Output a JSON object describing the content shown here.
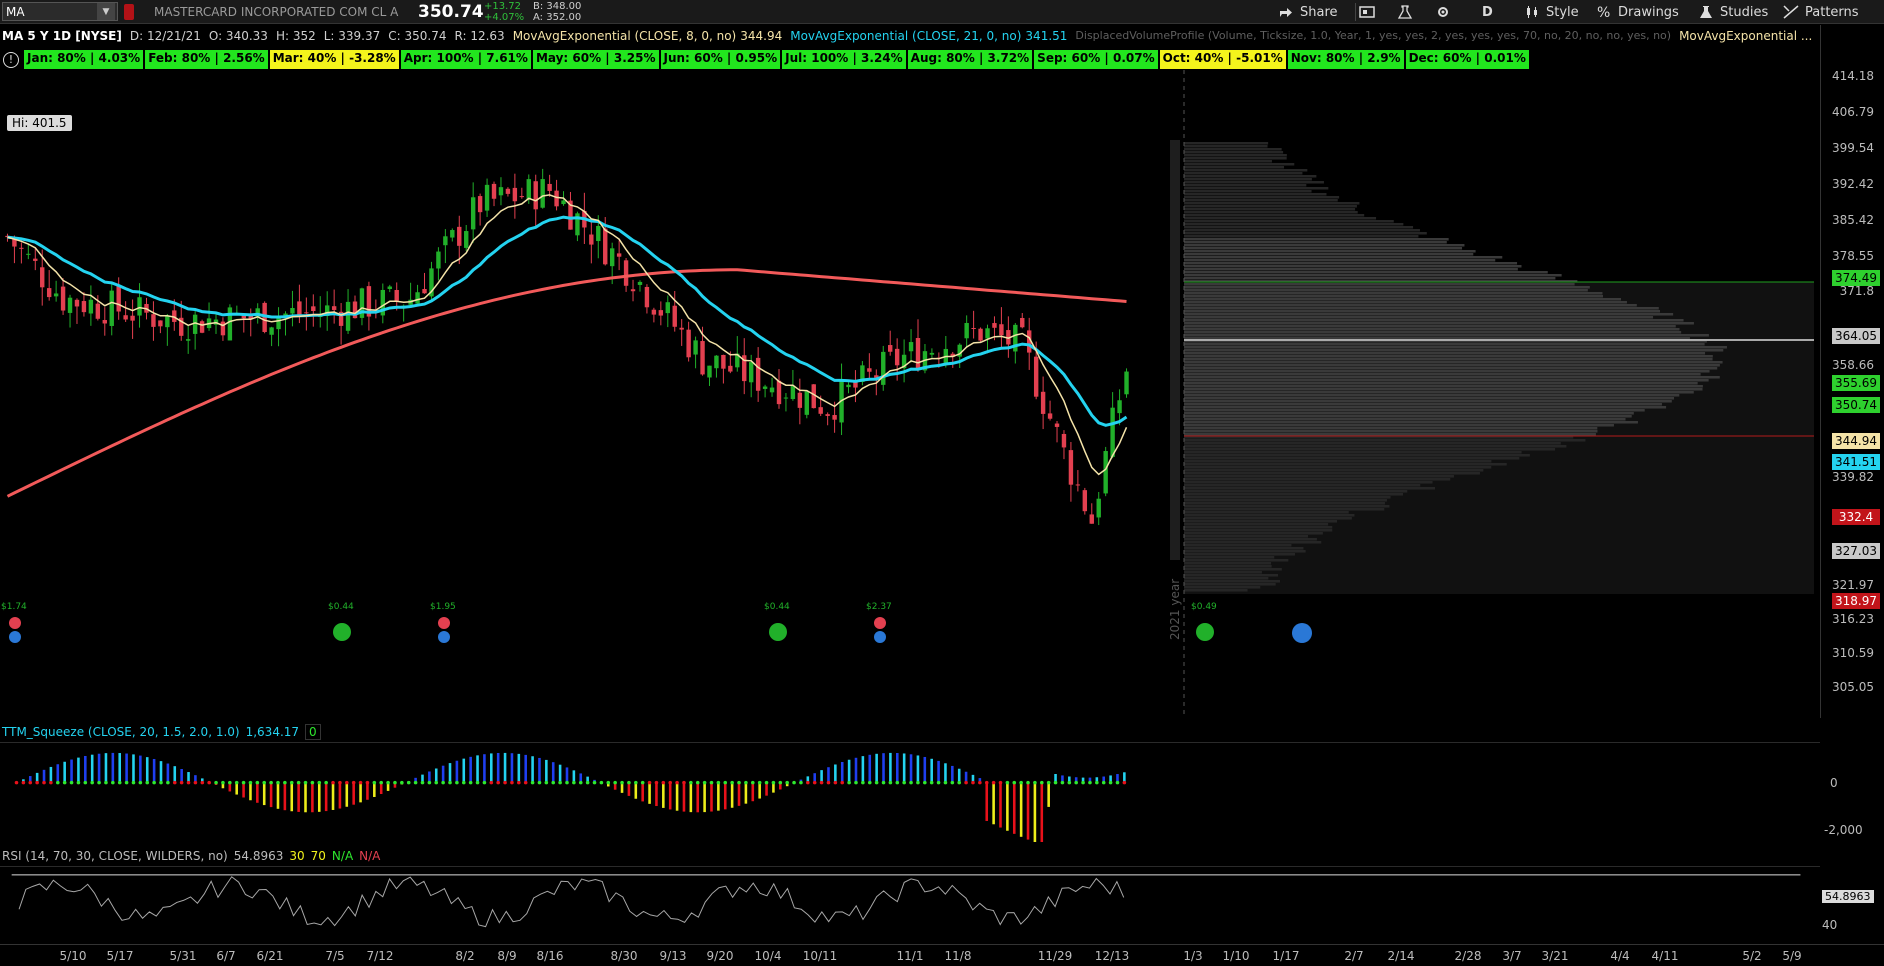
{
  "header": {
    "symbol": "MA",
    "company": "MASTERCARD INCORPORATED COM CL A",
    "last": "350.74",
    "net_change": "+13.72",
    "pct_change": "+4.07%",
    "bid": "B: 348.00",
    "ask": "A: 352.00",
    "share_label": "Share",
    "aggregation": "D",
    "style_label": "Style",
    "drawings_label": "Drawings",
    "studies_label": "Studies",
    "patterns_label": "Patterns"
  },
  "study_strip": {
    "chart_id": "MA 5 Y 1D [NYSE]",
    "date": "D: 12/21/21",
    "open": "O: 340.33",
    "high": "H: 352",
    "low": "L: 339.37",
    "close": "C: 350.74",
    "range": "R: 12.63",
    "ema8_label": "MovAvgExponential (CLOSE, 8, 0, no)",
    "ema8_value": "344.94",
    "ema21_label": "MovAvgExponential (CLOSE, 21, 0, no)",
    "ema21_value": "341.51",
    "dvp_label": "DisplacedVolumeProfile (Volume, Ticksize, 1.0, Year, 1, yes, yes, 2, yes, yes, yes, 70, no, 20, no, no, yes, no)",
    "ema_more_label": "MovAvgExponential ..."
  },
  "seasonality": [
    {
      "text": "Jan: 80% | 4.03%",
      "color": "#22e61e"
    },
    {
      "text": "Feb: 80% | 2.56%",
      "color": "#22e61e"
    },
    {
      "text": "Mar: 40% | -3.28%",
      "color": "#f4f41c"
    },
    {
      "text": "Apr: 100% | 7.61%",
      "color": "#22e61e"
    },
    {
      "text": "May: 60% | 3.25%",
      "color": "#22e61e"
    },
    {
      "text": "Jun: 60% | 0.95%",
      "color": "#22e61e"
    },
    {
      "text": "Jul: 100% | 3.24%",
      "color": "#22e61e"
    },
    {
      "text": "Aug: 80% | 3.72%",
      "color": "#22e61e"
    },
    {
      "text": "Sep: 60% | 0.07%",
      "color": "#22e61e"
    },
    {
      "text": "Oct: 40% | -5.01%",
      "color": "#f4f41c"
    },
    {
      "text": "Nov: 80% | 2.9%",
      "color": "#22e61e"
    },
    {
      "text": "Dec: 60% | 0.01%",
      "color": "#22e61e"
    }
  ],
  "hi_label": "Hi: 401.5",
  "period_label": "2021 year",
  "price_axis": [
    "414.18",
    "406.79",
    "399.54",
    "392.42",
    "385.42",
    "378.55",
    "371.8",
    "358.66",
    "339.82",
    "321.97",
    "316.23",
    "310.59",
    "305.05"
  ],
  "price_tags": [
    {
      "text": "374.49",
      "color": "#2ed02e"
    },
    {
      "text": "364.05",
      "color": "#c8c8c8"
    },
    {
      "text": "355.69",
      "color": "#2ed02e"
    },
    {
      "text": "350.74",
      "color": "#2ed02e"
    },
    {
      "text": "344.94",
      "color": "#f4e3a8"
    },
    {
      "text": "341.51",
      "color": "#24d3f0"
    },
    {
      "text": "332.4",
      "color": "#c2141a"
    },
    {
      "text": "327.03",
      "color": "#c8c8c8"
    },
    {
      "text": "318.97",
      "color": "#c2141a"
    }
  ],
  "dividends": [
    {
      "date_value": "$1.74",
      "kind": "earnings"
    },
    {
      "date_value": "$0.44",
      "kind": "dividend"
    },
    {
      "date_value": "$1.95",
      "kind": "earnings"
    },
    {
      "date_value": "$0.44",
      "kind": "dividend"
    },
    {
      "date_value": "$2.37",
      "kind": "earnings"
    },
    {
      "date_value": "$0.49",
      "kind": "dividend"
    }
  ],
  "squeeze": {
    "label": "TTM_Squeeze (CLOSE, 20, 1.5, 2.0, 1.0)",
    "value": "1,634.17",
    "flag": "0",
    "axis": [
      "0",
      "-2,000"
    ]
  },
  "rsi": {
    "label": "RSI (14, 70, 30, CLOSE, WILDERS, no)",
    "value": "54.8963",
    "ob": "30",
    "os": "70",
    "na1": "N/A",
    "na2": "N/A",
    "axis_value": "54.8963",
    "axis_40": "40"
  },
  "time_axis": [
    "5/10",
    "5/17",
    "5/31",
    "6/7",
    "6/21",
    "7/5",
    "7/12",
    "8/2",
    "8/9",
    "8/16",
    "8/30",
    "9/13",
    "9/20",
    "10/4",
    "10/11",
    "11/1",
    "11/8",
    "11/29",
    "12/13",
    "1/3",
    "1/10",
    "1/17",
    "2/7",
    "2/14",
    "2/28",
    "3/7",
    "3/21",
    "4/4",
    "4/11",
    "5/2",
    "5/9"
  ],
  "colors": {
    "ema8": "#f4e3a8",
    "ema21": "#24d3f0",
    "sma200": "#f25a5a",
    "up_candle": "#21b02a",
    "down_candle": "#e34050"
  }
}
